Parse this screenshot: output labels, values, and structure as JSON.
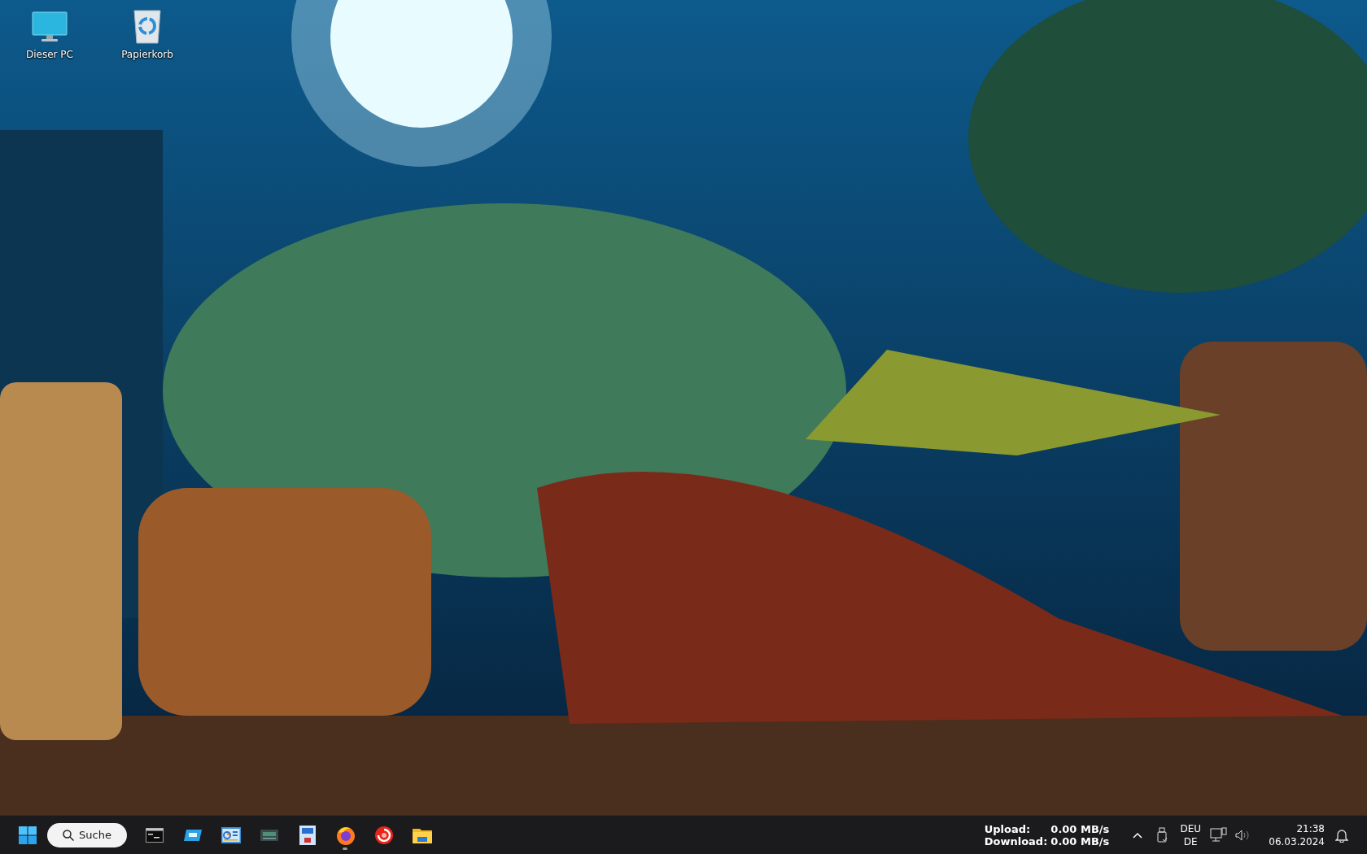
{
  "desktop": {
    "icons": [
      {
        "label": "Dieser PC",
        "kind": "monitor"
      },
      {
        "label": "Papierkorb",
        "kind": "recycle"
      }
    ]
  },
  "taskbar": {
    "search": {
      "label": "Suche"
    },
    "apps": [
      {
        "kind": "terminal",
        "running": false
      },
      {
        "kind": "window",
        "running": false
      },
      {
        "kind": "dashboard",
        "running": false
      },
      {
        "kind": "drive",
        "running": false
      },
      {
        "kind": "idcard",
        "running": false
      },
      {
        "kind": "browser",
        "running": true
      },
      {
        "kind": "disc",
        "running": false
      },
      {
        "kind": "folder",
        "running": false
      }
    ],
    "network_speed": {
      "upload_label": "Upload:",
      "upload_value": "0.00 MB/s",
      "download_label": "Download:",
      "download_value": "0.00 MB/s"
    },
    "language": {
      "code": "DEU",
      "layout": "DE"
    },
    "clock": {
      "time": "21:38",
      "date": "06.03.2024"
    }
  }
}
